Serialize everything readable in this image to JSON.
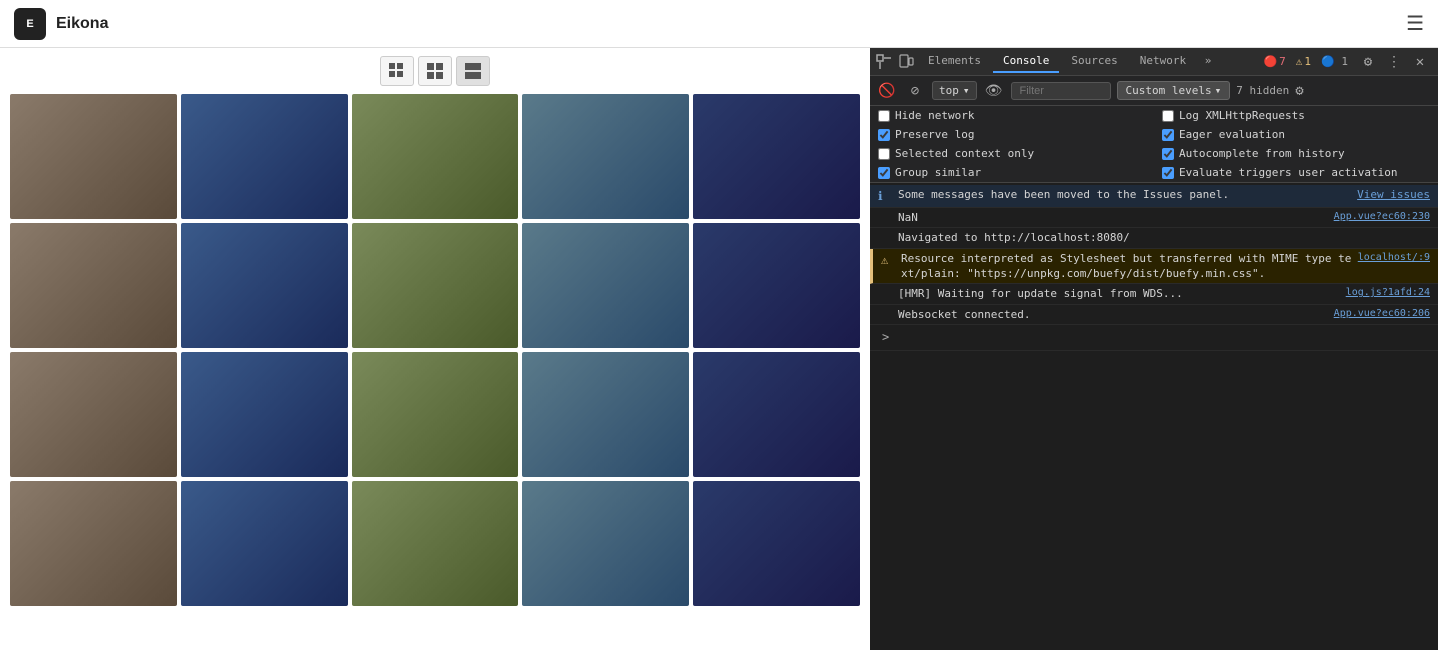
{
  "app": {
    "logo_text": "E",
    "title": "Eikona",
    "hamburger_label": "☰"
  },
  "gallery": {
    "grid_buttons": [
      {
        "id": "grid-small",
        "icon": "small-grid"
      },
      {
        "id": "grid-medium",
        "icon": "medium-grid"
      },
      {
        "id": "grid-large",
        "icon": "large-grid",
        "active": true
      }
    ],
    "photo_count": 20
  },
  "devtools": {
    "tabs": [
      {
        "label": "Elements",
        "id": "elements"
      },
      {
        "label": "Console",
        "id": "console",
        "active": true
      },
      {
        "label": "Sources",
        "id": "sources"
      },
      {
        "label": "Network",
        "id": "network"
      }
    ],
    "more_icon": "»",
    "error_count": "7",
    "warn_count": "1",
    "info_count": "1",
    "toolbar": {
      "clear_icon": "🚫",
      "filter_icon": "⊘",
      "context_value": "top",
      "context_dropdown": "▾",
      "eye_icon": "👁",
      "filter_placeholder": "Filter",
      "custom_levels_label": "Custom levels",
      "custom_levels_arrow": "▾",
      "hidden_count": "7 hidden",
      "settings_icon": "⚙"
    },
    "checkboxes": [
      {
        "id": "hide-network",
        "label": "Hide network",
        "checked": false
      },
      {
        "id": "log-xmlhttprequests",
        "label": "Log XMLHttpRequests",
        "checked": false
      },
      {
        "id": "preserve-log",
        "label": "Preserve log",
        "checked": true
      },
      {
        "id": "eager-evaluation",
        "label": "Eager evaluation",
        "checked": true
      },
      {
        "id": "selected-context-only",
        "label": "Selected context only",
        "checked": false
      },
      {
        "id": "autocomplete-from-history",
        "label": "Autocomplete from history",
        "checked": true
      },
      {
        "id": "group-similar",
        "label": "Group similar",
        "checked": true
      },
      {
        "id": "evaluate-triggers-user-activation",
        "label": "Evaluate triggers user activation",
        "checked": true
      }
    ],
    "console_lines": [
      {
        "type": "info",
        "icon": "ℹ",
        "text": "Some messages have been moved to the Issues panel.",
        "link_text": "View issues",
        "source": ""
      },
      {
        "type": "nan",
        "icon": "",
        "text": "NaN",
        "link_text": "",
        "source": "App.vue?ec60:230"
      },
      {
        "type": "nav",
        "icon": "",
        "text": "Navigated to http://localhost:8080/",
        "link_text": "",
        "source": ""
      },
      {
        "type": "warn",
        "icon": "⚠",
        "text": "Resource interpreted as Stylesheet but transferred with MIME type text/plain: \"https://unpkg.com/buefy/dist/buefy.min.css\".",
        "link_text": "",
        "source": "localhost/:9"
      },
      {
        "type": "normal",
        "icon": "",
        "text": "[HMR] Waiting for update signal from WDS...",
        "link_text": "",
        "source": "log.js?1afd:24"
      },
      {
        "type": "normal",
        "icon": "",
        "text": "Websocket connected.",
        "link_text": "",
        "source": "App.vue?ec60:206"
      }
    ],
    "prompt_chevron": ">"
  }
}
